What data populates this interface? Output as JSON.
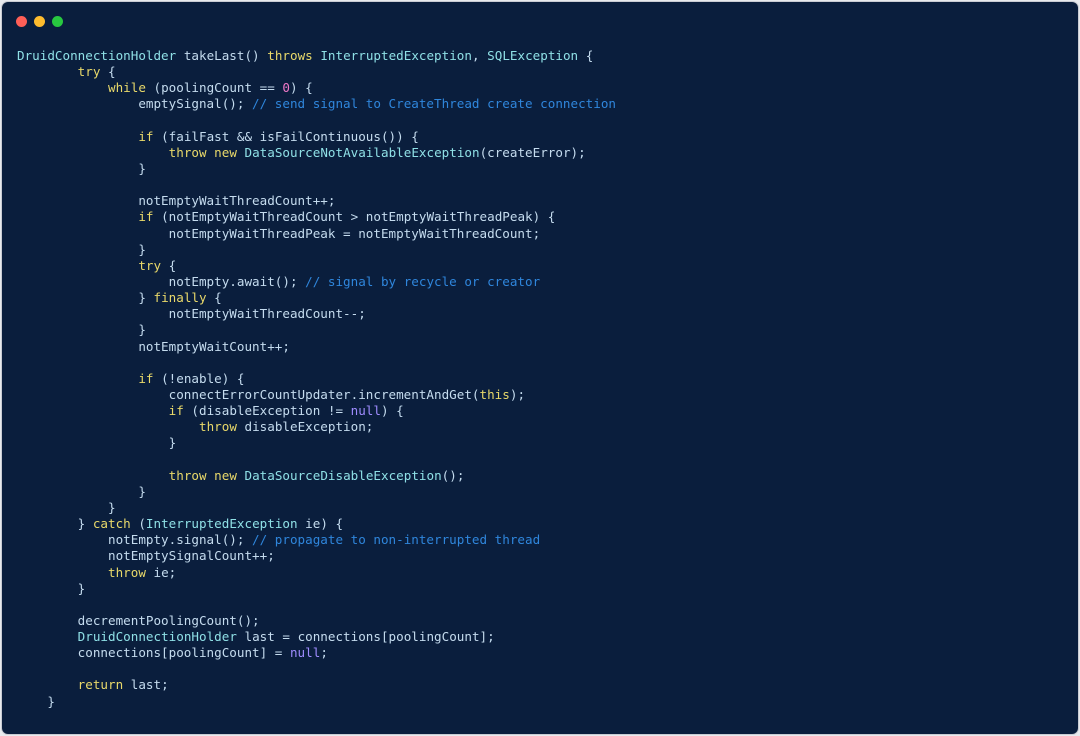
{
  "window": {
    "buttons": [
      {
        "name": "close",
        "color": "#ff5f57"
      },
      {
        "name": "minimize",
        "color": "#febc2e"
      },
      {
        "name": "maximize",
        "color": "#28c840"
      }
    ]
  },
  "theme": {
    "background": "#0a1e3d",
    "plain": "#c5dcef",
    "keyword": "#e9d96a",
    "type": "#8fe0e6",
    "comment": "#2f86dc",
    "number": "#ef78c8",
    "literal": "#9f8cff"
  },
  "code": {
    "lines": [
      [
        {
          "t": "ty",
          "v": "DruidConnectionHolder"
        },
        {
          "t": "pl",
          "v": " takeLast() "
        },
        {
          "t": "kw",
          "v": "throws"
        },
        {
          "t": "pl",
          "v": " "
        },
        {
          "t": "ty",
          "v": "InterruptedException"
        },
        {
          "t": "pl",
          "v": ", "
        },
        {
          "t": "ty",
          "v": "SQLException"
        },
        {
          "t": "pl",
          "v": " {"
        }
      ],
      [
        {
          "t": "pl",
          "v": "        "
        },
        {
          "t": "kw",
          "v": "try"
        },
        {
          "t": "pl",
          "v": " {"
        }
      ],
      [
        {
          "t": "pl",
          "v": "            "
        },
        {
          "t": "kw",
          "v": "while"
        },
        {
          "t": "pl",
          "v": " (poolingCount == "
        },
        {
          "t": "num",
          "v": "0"
        },
        {
          "t": "pl",
          "v": ") {"
        }
      ],
      [
        {
          "t": "pl",
          "v": "                emptySignal(); "
        },
        {
          "t": "cmt",
          "v": "// send signal to CreateThread create connection"
        }
      ],
      [],
      [
        {
          "t": "pl",
          "v": "                "
        },
        {
          "t": "kw",
          "v": "if"
        },
        {
          "t": "pl",
          "v": " (failFast && isFailContinuous()) {"
        }
      ],
      [
        {
          "t": "pl",
          "v": "                    "
        },
        {
          "t": "kw",
          "v": "throw"
        },
        {
          "t": "pl",
          "v": " "
        },
        {
          "t": "kw",
          "v": "new"
        },
        {
          "t": "pl",
          "v": " "
        },
        {
          "t": "ty",
          "v": "DataSourceNotAvailableException"
        },
        {
          "t": "pl",
          "v": "(createError);"
        }
      ],
      [
        {
          "t": "pl",
          "v": "                }"
        }
      ],
      [],
      [
        {
          "t": "pl",
          "v": "                notEmptyWaitThreadCount++;"
        }
      ],
      [
        {
          "t": "pl",
          "v": "                "
        },
        {
          "t": "kw",
          "v": "if"
        },
        {
          "t": "pl",
          "v": " (notEmptyWaitThreadCount > notEmptyWaitThreadPeak) {"
        }
      ],
      [
        {
          "t": "pl",
          "v": "                    notEmptyWaitThreadPeak = notEmptyWaitThreadCount;"
        }
      ],
      [
        {
          "t": "pl",
          "v": "                }"
        }
      ],
      [
        {
          "t": "pl",
          "v": "                "
        },
        {
          "t": "kw",
          "v": "try"
        },
        {
          "t": "pl",
          "v": " {"
        }
      ],
      [
        {
          "t": "pl",
          "v": "                    notEmpty.await(); "
        },
        {
          "t": "cmt",
          "v": "// signal by recycle or creator"
        }
      ],
      [
        {
          "t": "pl",
          "v": "                } "
        },
        {
          "t": "kw",
          "v": "finally"
        },
        {
          "t": "pl",
          "v": " {"
        }
      ],
      [
        {
          "t": "pl",
          "v": "                    notEmptyWaitThreadCount--;"
        }
      ],
      [
        {
          "t": "pl",
          "v": "                }"
        }
      ],
      [
        {
          "t": "pl",
          "v": "                notEmptyWaitCount++;"
        }
      ],
      [],
      [
        {
          "t": "pl",
          "v": "                "
        },
        {
          "t": "kw",
          "v": "if"
        },
        {
          "t": "pl",
          "v": " (!enable) {"
        }
      ],
      [
        {
          "t": "pl",
          "v": "                    connectErrorCountUpdater.incrementAndGet("
        },
        {
          "t": "kw",
          "v": "this"
        },
        {
          "t": "pl",
          "v": ");"
        }
      ],
      [
        {
          "t": "pl",
          "v": "                    "
        },
        {
          "t": "kw",
          "v": "if"
        },
        {
          "t": "pl",
          "v": " (disableException != "
        },
        {
          "t": "lit",
          "v": "null"
        },
        {
          "t": "pl",
          "v": ") {"
        }
      ],
      [
        {
          "t": "pl",
          "v": "                        "
        },
        {
          "t": "kw",
          "v": "throw"
        },
        {
          "t": "pl",
          "v": " disableException;"
        }
      ],
      [
        {
          "t": "pl",
          "v": "                    }"
        }
      ],
      [],
      [
        {
          "t": "pl",
          "v": "                    "
        },
        {
          "t": "kw",
          "v": "throw"
        },
        {
          "t": "pl",
          "v": " "
        },
        {
          "t": "kw",
          "v": "new"
        },
        {
          "t": "pl",
          "v": " "
        },
        {
          "t": "ty",
          "v": "DataSourceDisableException"
        },
        {
          "t": "pl",
          "v": "();"
        }
      ],
      [
        {
          "t": "pl",
          "v": "                }"
        }
      ],
      [
        {
          "t": "pl",
          "v": "            }"
        }
      ],
      [
        {
          "t": "pl",
          "v": "        } "
        },
        {
          "t": "kw",
          "v": "catch"
        },
        {
          "t": "pl",
          "v": " ("
        },
        {
          "t": "ty",
          "v": "InterruptedException"
        },
        {
          "t": "pl",
          "v": " ie) {"
        }
      ],
      [
        {
          "t": "pl",
          "v": "            notEmpty.signal(); "
        },
        {
          "t": "cmt",
          "v": "// propagate to non-interrupted thread"
        }
      ],
      [
        {
          "t": "pl",
          "v": "            notEmptySignalCount++;"
        }
      ],
      [
        {
          "t": "pl",
          "v": "            "
        },
        {
          "t": "kw",
          "v": "throw"
        },
        {
          "t": "pl",
          "v": " ie;"
        }
      ],
      [
        {
          "t": "pl",
          "v": "        }"
        }
      ],
      [],
      [
        {
          "t": "pl",
          "v": "        decrementPoolingCount();"
        }
      ],
      [
        {
          "t": "pl",
          "v": "        "
        },
        {
          "t": "ty",
          "v": "DruidConnectionHolder"
        },
        {
          "t": "pl",
          "v": " last = connections[poolingCount];"
        }
      ],
      [
        {
          "t": "pl",
          "v": "        connections[poolingCount] = "
        },
        {
          "t": "lit",
          "v": "null"
        },
        {
          "t": "pl",
          "v": ";"
        }
      ],
      [],
      [
        {
          "t": "pl",
          "v": "        "
        },
        {
          "t": "kw",
          "v": "return"
        },
        {
          "t": "pl",
          "v": " last;"
        }
      ],
      [
        {
          "t": "pl",
          "v": "    }"
        }
      ]
    ]
  }
}
